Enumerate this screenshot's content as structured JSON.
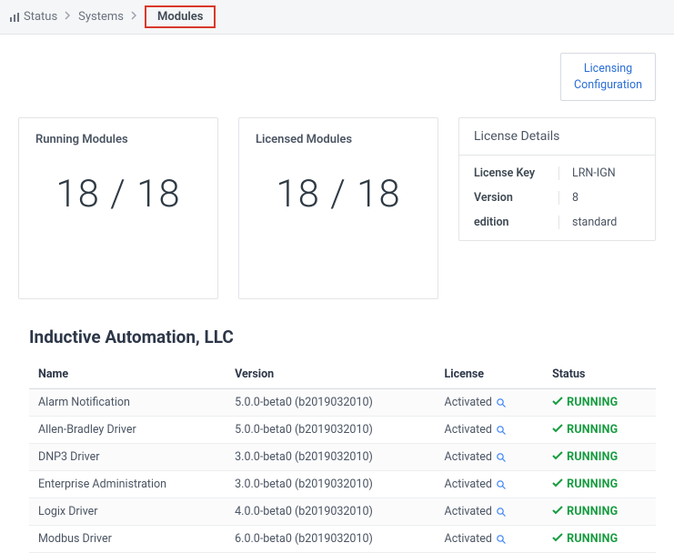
{
  "breadcrumb": {
    "items": [
      "Status",
      "Systems",
      "Modules"
    ]
  },
  "licensing_button": {
    "line1": "Licensing",
    "line2": "Configuration"
  },
  "stats": {
    "running": {
      "title": "Running Modules",
      "value": "18 / 18"
    },
    "licensed": {
      "title": "Licensed Modules",
      "value": "18 / 18"
    }
  },
  "license_details": {
    "header": "License Details",
    "rows": [
      {
        "k": "License Key",
        "v": "LRN-IGN"
      },
      {
        "k": "Version",
        "v": "8"
      },
      {
        "k": "edition",
        "v": "standard"
      }
    ]
  },
  "vendor_heading": "Inductive Automation, LLC",
  "columns": {
    "name": "Name",
    "version": "Version",
    "license": "License",
    "status": "Status"
  },
  "status_running_label": "RUNNING",
  "modules": [
    {
      "name": "Alarm Notification",
      "version": "5.0.0-beta0 (b2019032010)",
      "license": "Activated",
      "status": "RUNNING"
    },
    {
      "name": "Allen-Bradley Driver",
      "version": "5.0.0-beta0 (b2019032010)",
      "license": "Activated",
      "status": "RUNNING"
    },
    {
      "name": "DNP3 Driver",
      "version": "3.0.0-beta0 (b2019032010)",
      "license": "Activated",
      "status": "RUNNING"
    },
    {
      "name": "Enterprise Administration",
      "version": "3.0.0-beta0 (b2019032010)",
      "license": "Activated",
      "status": "RUNNING"
    },
    {
      "name": "Logix Driver",
      "version": "4.0.0-beta0 (b2019032010)",
      "license": "Activated",
      "status": "RUNNING"
    },
    {
      "name": "Modbus Driver",
      "version": "6.0.0-beta0 (b2019032010)",
      "license": "Activated",
      "status": "RUNNING"
    }
  ]
}
